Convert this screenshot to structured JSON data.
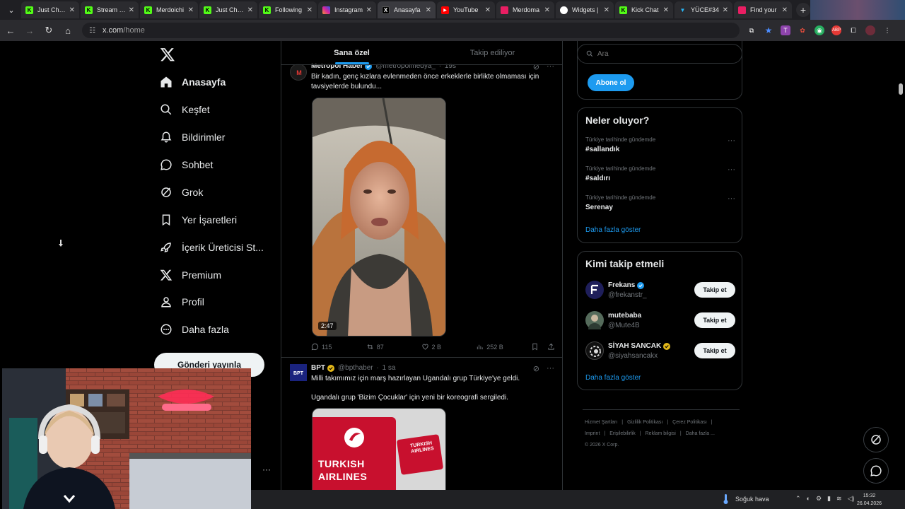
{
  "browser": {
    "tabs": [
      {
        "title": "Just Chatti",
        "fav": "K",
        "fav_color": "#53fc18"
      },
      {
        "title": "Stream - K",
        "fav": "K",
        "fav_color": "#53fc18"
      },
      {
        "title": "Merdoichi",
        "fav": "K",
        "fav_color": "#53fc18"
      },
      {
        "title": "Just Chatti",
        "fav": "K",
        "fav_color": "#53fc18"
      },
      {
        "title": "Following",
        "fav": "K",
        "fav_color": "#53fc18"
      },
      {
        "title": "Instagram",
        "fav": "",
        "fav_color": "#d6249f"
      },
      {
        "title": "Anasayfa",
        "fav": "X",
        "fav_color": "#000000"
      },
      {
        "title": "YouTube",
        "fav": "▶",
        "fav_color": "#ff0000"
      },
      {
        "title": "Merdoma",
        "fav": "",
        "fav_color": "#e91e63"
      },
      {
        "title": "Widgets |",
        "fav": "",
        "fav_color": "#ffffff"
      },
      {
        "title": "Kick Chat",
        "fav": "K",
        "fav_color": "#53fc18"
      },
      {
        "title": "YÜCE#34",
        "fav": "▼",
        "fav_color": "#29b6f6"
      },
      {
        "title": "Find your",
        "fav": "",
        "fav_color": "#e91e63"
      }
    ],
    "url_host": "x.com",
    "url_path": "/home"
  },
  "nav": {
    "items": [
      {
        "label": "Anasayfa",
        "icon": "home-icon"
      },
      {
        "label": "Keşfet",
        "icon": "search-icon"
      },
      {
        "label": "Bildirimler",
        "icon": "bell-icon"
      },
      {
        "label": "Sohbet",
        "icon": "chat-icon"
      },
      {
        "label": "Grok",
        "icon": "grok-icon"
      },
      {
        "label": "Yer İşaretleri",
        "icon": "bookmark-icon"
      },
      {
        "label": "İçerik Üreticisi St...",
        "icon": "rocket-icon"
      },
      {
        "label": "Premium",
        "icon": "x-icon"
      },
      {
        "label": "Profil",
        "icon": "person-icon"
      },
      {
        "label": "Daha fazla",
        "icon": "more-circle-icon"
      }
    ],
    "post_button": "Gönderi yayınla"
  },
  "feed": {
    "tabs": [
      "Sana özel",
      "Takip ediliyor"
    ],
    "tweets": [
      {
        "name": "Metropol Haber",
        "handle": "@metropolmedya_",
        "time": "19s",
        "text": "Bir kadın, genç kızlara evlenmeden önce erkeklerle birlikte olmaması için tavsiyelerde bulundu...",
        "duration": "2:47",
        "replies": "115",
        "reposts": "87",
        "likes": "2 B",
        "views": "252 B"
      },
      {
        "name": "BPT",
        "handle": "@bpthaber",
        "time": "1 sa",
        "text1": "Milli takımımız için marş hazırlayan Ugandalı grup Türkiye'ye geldi.",
        "text2": "Ugandalı grup 'Bizim Çocuklar' için yeni bir koreografi sergiledi.",
        "media_sign1": "TURKISH",
        "media_sign2": "AIRLINES",
        "media_sign3": "TURKISH AIRLINES"
      }
    ]
  },
  "right": {
    "search_placeholder": "Ara",
    "subscribe_button": "Abone ol",
    "trends_title": "Neler oluyor?",
    "trends": [
      {
        "context": "Türkiye tarihinde gündemde",
        "tag": "#sallandık"
      },
      {
        "context": "Türkiye tarihinde gündemde",
        "tag": "#saldırı"
      },
      {
        "context": "Türkiye tarihinde gündemde",
        "tag": "Serenay"
      }
    ],
    "show_more": "Daha fazla göster",
    "who_title": "Kimi takip etmeli",
    "who": [
      {
        "name": "Frekans",
        "handle": "@frekanstr_",
        "verified": "blue"
      },
      {
        "name": "mutebaba",
        "handle": "@Mute4B",
        "verified": ""
      },
      {
        "name": "SİYAH SANCAK",
        "handle": "@siyahsancakx",
        "verified": "gold"
      }
    ],
    "follow_label": "Takip et",
    "who_show_more": "Daha fazla göster",
    "footer_line1": [
      "Hizmet Şartları",
      "|",
      "Gizlilik Politikası",
      "|",
      "Çerez Politikası",
      "|"
    ],
    "footer_line2": [
      "Imprint",
      "|",
      "Erişilebilirlik",
      "|",
      "Reklam bilgisi",
      "|",
      "Daha fazla ..."
    ],
    "footer_copy": "© 2026 X Corp."
  },
  "taskbar": {
    "weather": "Soğuk hava",
    "time": "15:32",
    "date": "26.04.2026"
  },
  "colors": {
    "accent": "#1d9bf0",
    "background": "#000000",
    "border": "#2f3336",
    "muted": "#71767b"
  }
}
